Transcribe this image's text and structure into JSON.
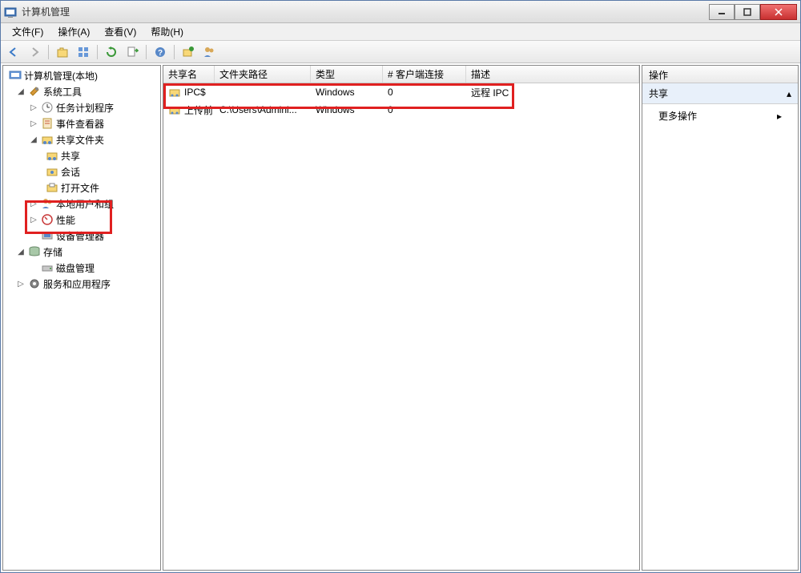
{
  "window": {
    "title": "计算机管理"
  },
  "menu": {
    "file": "文件(F)",
    "action": "操作(A)",
    "view": "查看(V)",
    "help": "帮助(H)"
  },
  "tree": {
    "root": "计算机管理(本地)",
    "system_tools": "系统工具",
    "task_scheduler": "任务计划程序",
    "event_viewer": "事件查看器",
    "shared_folders": "共享文件夹",
    "shares": "共享",
    "sessions": "会话",
    "open_files": "打开文件",
    "local_users": "本地用户和组",
    "performance": "性能",
    "device_manager": "设备管理器",
    "storage": "存储",
    "disk_management": "磁盘管理",
    "services_apps": "服务和应用程序"
  },
  "list": {
    "columns": {
      "share_name": "共享名",
      "folder_path": "文件夹路径",
      "type": "类型",
      "client_connections": "# 客户端连接",
      "description": "描述"
    },
    "rows": [
      {
        "name": "IPC$",
        "path": "",
        "type": "Windows",
        "connections": "0",
        "description": "远程 IPC"
      },
      {
        "name": "上传前",
        "path": "C:\\Users\\Admini...",
        "type": "Windows",
        "connections": "0",
        "description": ""
      }
    ]
  },
  "actions": {
    "header": "操作",
    "section": "共享",
    "more": "更多操作"
  }
}
